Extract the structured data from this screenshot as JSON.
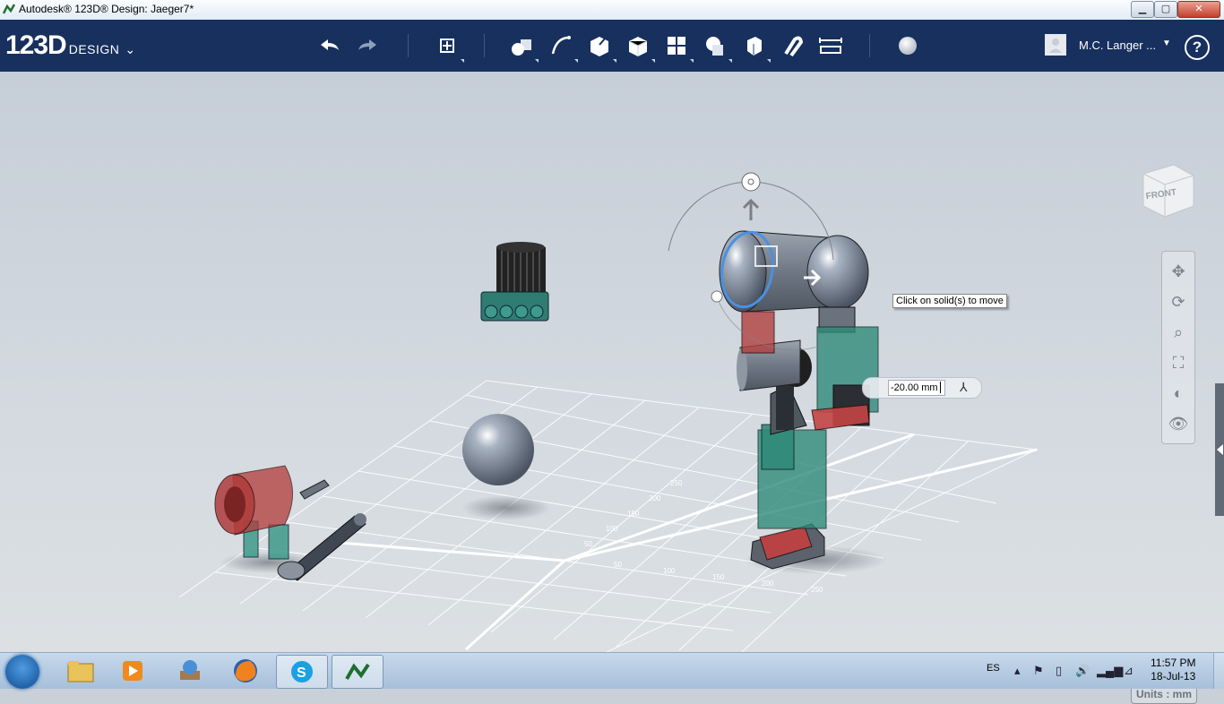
{
  "window": {
    "title": "Autodesk® 123D® Design: Jaeger7*"
  },
  "brand": {
    "number": "123D",
    "word": "DESIGN"
  },
  "toolbar": {
    "tools": [
      "undo-icon",
      "redo-icon",
      "transform-icon",
      "primitives-icon",
      "sketch-icon",
      "construct-icon",
      "modify-icon",
      "pattern-icon",
      "grouping-icon",
      "combine-icon",
      "snap-icon",
      "measure-icon",
      "material-icon"
    ]
  },
  "user": {
    "name": "M.C. Langer ..."
  },
  "viewport": {
    "tooltip": "Click on solid(s) to move",
    "dimension_value": "-20.00 mm",
    "viewcube_face": "FRONT",
    "units": "Units : mm",
    "grid_labels": [
      "50",
      "100",
      "150",
      "200",
      "250",
      "50",
      "100",
      "150",
      "200",
      "250"
    ]
  },
  "taskbar": {
    "apps": [
      "explorer-icon",
      "media-player-icon",
      "games-icon",
      "firefox-icon",
      "skype-icon",
      "123d-design-icon"
    ],
    "language": "ES",
    "time": "11:57 PM",
    "date": "18-Jul-13"
  },
  "colors": {
    "toolbar_bg": "#17305e",
    "viewport_bg": "#cdd3da",
    "accent_blue": "#4a90e2"
  }
}
